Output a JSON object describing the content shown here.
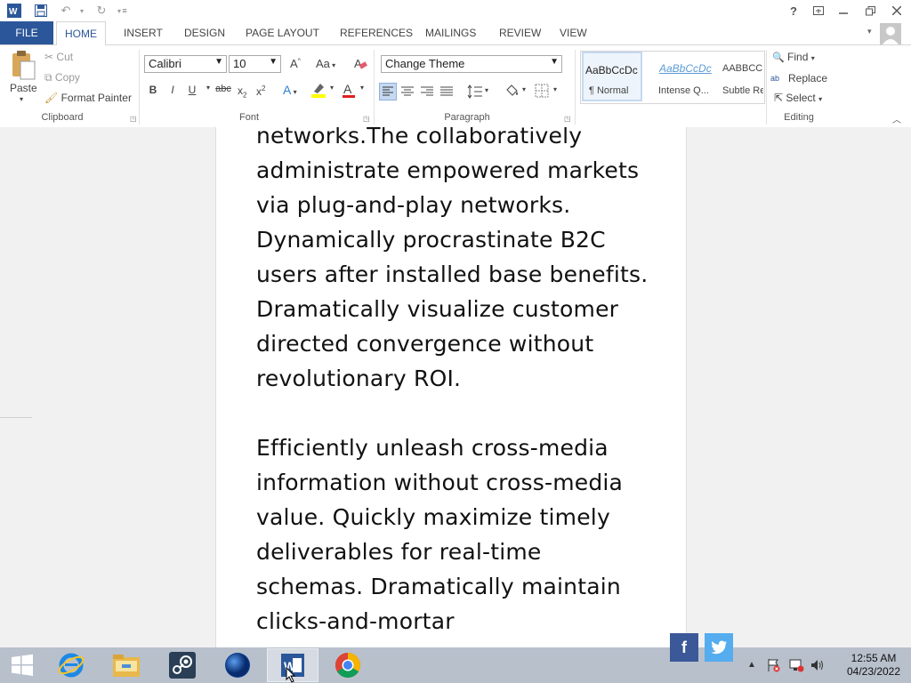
{
  "titlebar": {
    "help": "?",
    "window_buttons": [
      "ribbon-display-icon",
      "minimize-icon",
      "restore-icon",
      "close-icon"
    ]
  },
  "tabs": [
    "FILE",
    "HOME",
    "INSERT",
    "DESIGN",
    "PAGE LAYOUT",
    "REFERENCES",
    "MAILINGS",
    "REVIEW",
    "VIEW"
  ],
  "clipboard": {
    "paste": "Paste",
    "cut": "Cut",
    "copy": "Copy",
    "format_painter": "Format Painter",
    "label": "Clipboard"
  },
  "font": {
    "name": "Calibri",
    "size": "10",
    "grow": "A",
    "case": "Aa",
    "bold": "B",
    "italic": "I",
    "underline": "U",
    "strike": "abc",
    "subscript": "x",
    "superscript": "x",
    "effects": "A",
    "color": "A",
    "label": "Font"
  },
  "theme": {
    "value": "Change Theme"
  },
  "paragraph": {
    "label": "Paragraph"
  },
  "styles": [
    {
      "preview": "AaBbCcDc",
      "name": "¶ Normal"
    },
    {
      "preview": "AaBbCcDc",
      "name": "Intense Q..."
    },
    {
      "preview": "AABBCC",
      "name": "Subtle Re"
    }
  ],
  "editing": {
    "find": "Find",
    "replace": "Replace",
    "select": "Select",
    "label": "Editing"
  },
  "document": {
    "lines_p1": [
      "networks.The collaboratively",
      "administrate empowered markets",
      "via plug-and-play networks.",
      "Dynamically procrastinate B2C",
      "users after installed base benefits.",
      "Dramatically visualize customer",
      "directed convergence without",
      "revolutionary ROI."
    ],
    "lines_p2": [
      "Efficiently unleash cross-media",
      "information without cross-media",
      "value. Quickly maximize timely",
      "deliverables for real-time",
      "schemas. Dramatically maintain",
      "clicks-and-mortar"
    ]
  },
  "taskbar": {
    "apps": [
      "start-icon",
      "internet-explorer-icon",
      "file-explorer-icon",
      "steam-icon",
      "globe-icon",
      "word-icon",
      "chrome-icon"
    ],
    "social": {
      "facebook": "f",
      "twitter": "t"
    },
    "clock": {
      "time": "12:55 AM",
      "date": "04/23/2022"
    }
  },
  "colors": {
    "accent": "#2b579a",
    "taskbar": "#b8c0cc",
    "facebook": "#3b5998",
    "twitter": "#55acee"
  }
}
